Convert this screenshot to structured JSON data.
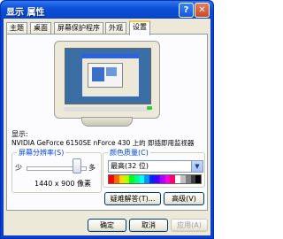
{
  "window": {
    "title": "显示 属性",
    "help_glyph": "?",
    "close_glyph": "✕"
  },
  "tabs": [
    {
      "label": "主题"
    },
    {
      "label": "桌面"
    },
    {
      "label": "屏幕保护程序"
    },
    {
      "label": "外观"
    },
    {
      "label": "设置"
    }
  ],
  "active_tab": "设置",
  "display": {
    "label": "显示:",
    "device": "NVIDIA GeForce 6150SE nForce 430 上的 即插即用监视器"
  },
  "resolution": {
    "group_label": "屏幕分辨率(S)",
    "less_label": "少",
    "more_label": "多",
    "value": "1440 x 900 像素",
    "slider_level": 0.85
  },
  "color_quality": {
    "group_label": "颜色质量(C)",
    "selected": "最高(32 位)",
    "dropdown_glyph": "▼",
    "palette": [
      "#ff0000",
      "#ff6a00",
      "#ffd800",
      "#b6ff00",
      "#00ff21",
      "#00ff90",
      "#00ffff",
      "#0094ff",
      "#0026ff",
      "#4800ff",
      "#b200ff",
      "#ff00dc",
      "#ff006e",
      "#ffffff",
      "#c0c0c0",
      "#808080",
      "#404040",
      "#000000"
    ]
  },
  "buttons": {
    "troubleshoot": "疑难解答(T)...",
    "advanced": "高级(V)",
    "ok": "确定",
    "cancel": "取消",
    "apply": "应用(A)"
  },
  "colors": {
    "titlebar": "#0b4fd6",
    "accent_tab": "#ffc83c",
    "group_title": "#0046d5"
  }
}
